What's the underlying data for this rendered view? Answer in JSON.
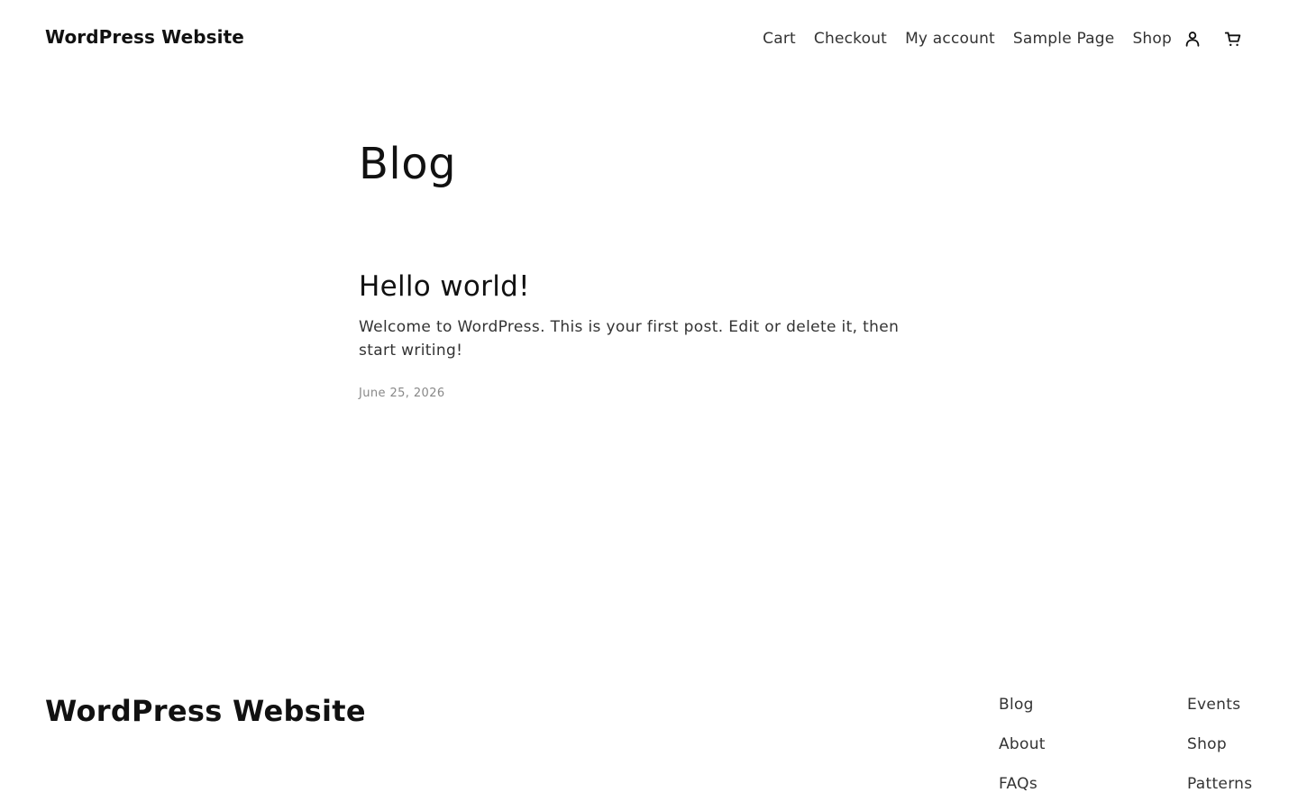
{
  "header": {
    "site_title": "WordPress Website",
    "nav": [
      "Cart",
      "Checkout",
      "My account",
      "Sample Page",
      "Shop"
    ],
    "icons": {
      "account": "account-icon",
      "cart": "cart-icon"
    }
  },
  "main": {
    "page_title": "Blog",
    "post": {
      "title": "Hello world!",
      "excerpt": "Welcome to WordPress. This is your first post. Edit or delete it, then start writing!",
      "date": "June 25, 2026"
    }
  },
  "footer": {
    "site_title": "WordPress Website",
    "col1": [
      "Blog",
      "About",
      "FAQs"
    ],
    "col2": [
      "Events",
      "Shop",
      "Patterns"
    ]
  }
}
